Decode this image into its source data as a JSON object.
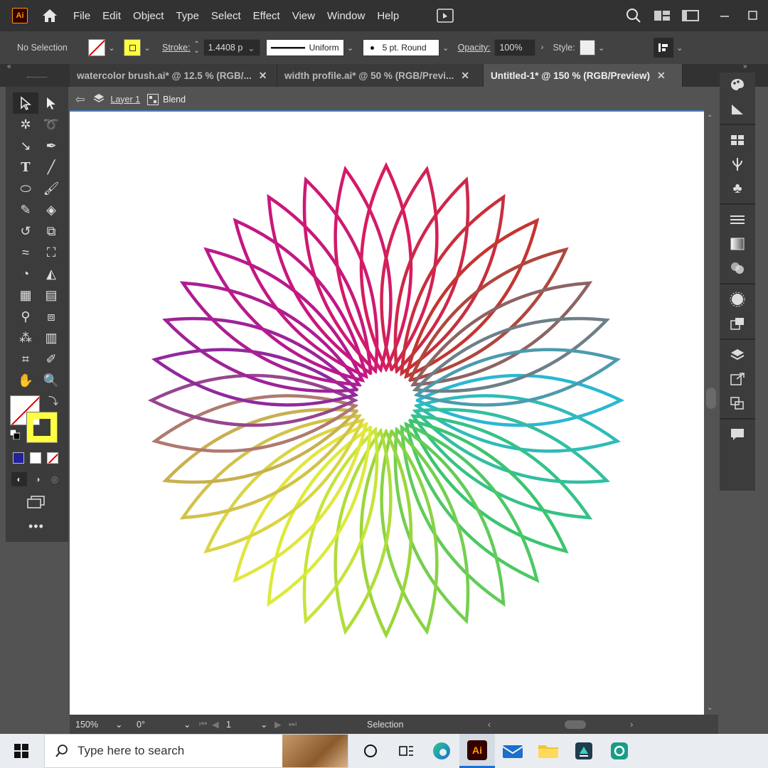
{
  "menubar": {
    "logo": "Ai",
    "items": [
      "File",
      "Edit",
      "Object",
      "Type",
      "Select",
      "Effect",
      "View",
      "Window",
      "Help"
    ]
  },
  "control": {
    "selection": "No Selection",
    "stroke_label": "Stroke:",
    "stroke_value": "1.4408 p",
    "profile": "Uniform",
    "brush": "5 pt. Round",
    "opacity_label": "Opacity:",
    "opacity_value": "100%",
    "style_label": "Style:"
  },
  "tabs": [
    {
      "label": "watercolor brush.ai* @ 12.5 % (RGB/..."
    },
    {
      "label": "width profile.ai* @ 50 % (RGB/Previ..."
    },
    {
      "label": "Untitled-1* @ 150 % (RGB/Preview)"
    }
  ],
  "breadcrumb": {
    "layer": "Layer 1",
    "object": "Blend"
  },
  "status": {
    "zoom": "150%",
    "rotation": "0°",
    "artboard": "1",
    "tool": "Selection"
  },
  "taskbar": {
    "search_placeholder": "Type here to search"
  },
  "colors": {
    "fill": "none",
    "stroke": "#ffff42",
    "accent": "#4a7fc0"
  },
  "artwork": {
    "petals": 36,
    "description_hint": "blend of rainbow lens-shaped petals"
  }
}
